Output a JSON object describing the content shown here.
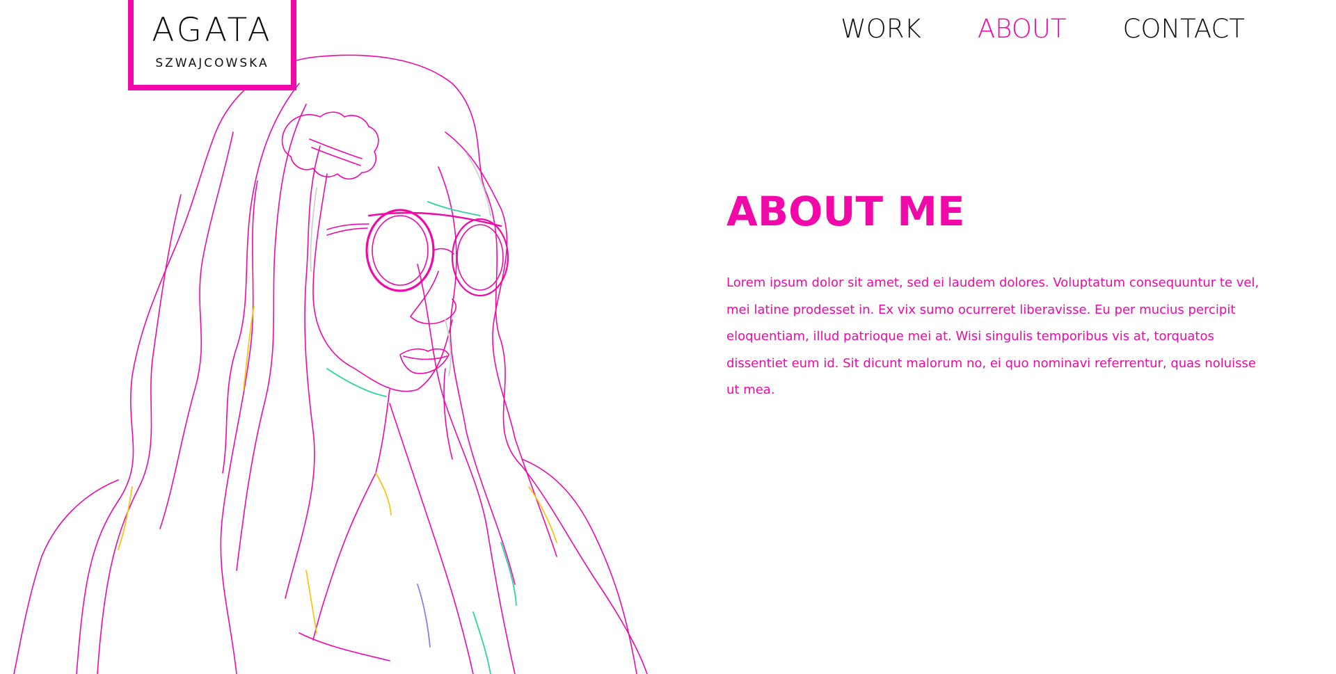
{
  "brand": {
    "name": "AGATA",
    "surname": "SZWAJCOWSKA"
  },
  "nav": {
    "items": [
      {
        "label": "WORK",
        "active": false
      },
      {
        "label": "ABOUT",
        "active": true
      },
      {
        "label": "CONTACT",
        "active": false
      }
    ]
  },
  "about": {
    "title": "ABOUT ME",
    "text": "Lorem ipsum dolor sit amet, sed ei laudem dolores. Voluptatum consequuntur te vel, mei latine prodesset in. Ex vix sumo ocurreret liberavisse. Eu per mucius percipit eloquentiam, illud patrioque mei at. Wisi singulis temporibus vis at, torquatos dissentiet eum id. Sit dicunt malorum no, ei quo nominavi referrentur, quas noluisse ut mea."
  },
  "colors": {
    "accent": "#f008a8",
    "text": "#111111",
    "background": "#ffffff",
    "line_accents": [
      "#f5c518",
      "#2bd4a0",
      "#8a7cf0",
      "#cfcfcf"
    ]
  },
  "illustration": {
    "icon": "woman-with-sunglasses-line-art"
  }
}
